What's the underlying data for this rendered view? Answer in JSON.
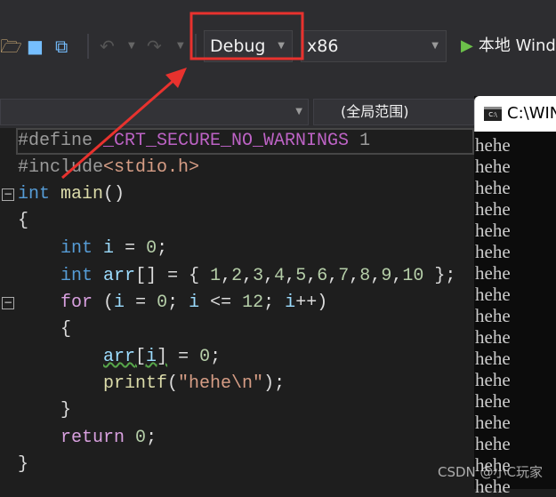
{
  "toolbar": {
    "open_icon": "open-folder-icon",
    "save_icon": "save-icon",
    "save_all_icon": "save-all-icon",
    "undo_icon": "undo-icon",
    "redo_icon": "redo-icon",
    "config": "Debug",
    "platform": "x86",
    "run_label": "本地 Windo"
  },
  "navbar": {
    "scope": "(全局范围)"
  },
  "editor": {
    "lines": [
      "#define _CRT_SECURE_NO_WARNINGS 1",
      "#include<stdio.h>",
      "int main()",
      "{",
      "int i = 0;",
      "int arr[] = { 1,2,3,4,5,6,7,8,9,10 };",
      "for (i = 0; i <= 12; i++)",
      "{",
      "arr[i] = 0;",
      "printf(\"hehe\\n\");",
      "}",
      "return 0;",
      "}"
    ]
  },
  "console": {
    "title": "C:\\WIN",
    "output": [
      "hehe",
      "hehe",
      "hehe",
      "hehe",
      "hehe",
      "hehe",
      "hehe",
      "hehe",
      "hehe",
      "hehe",
      "hehe",
      "hehe",
      "hehe",
      "hehe",
      "hehe",
      "hehe",
      "hehe"
    ]
  },
  "watermark": "CSDN @小C玩家",
  "colors": {
    "highlight": "#e8322e",
    "keyword": "#569cd6",
    "string": "#d69d85"
  }
}
